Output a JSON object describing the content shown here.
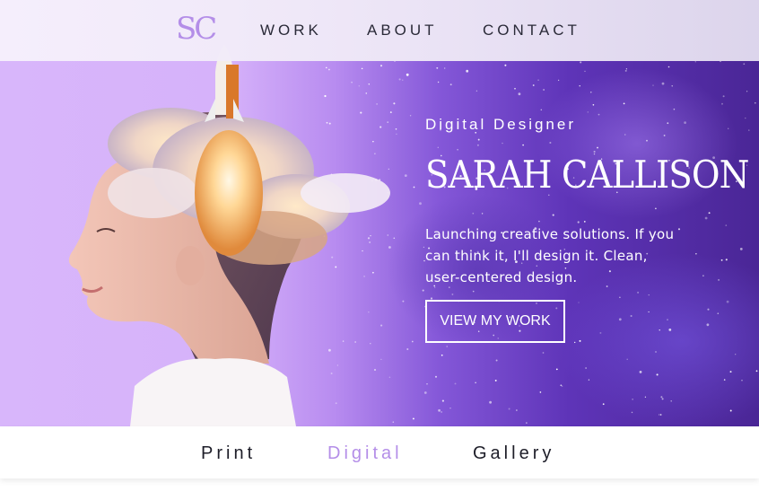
{
  "nav": {
    "logo": "SC",
    "links": [
      "WORK",
      "ABOUT",
      "CONTACT"
    ]
  },
  "hero": {
    "eyebrow": "Digital Designer",
    "name": "SARAH CALLISON",
    "tagline": "Launching creative solutions. If you can think it, I'll design it. Clean, user-centered design.",
    "cta_label": "VIEW MY WORK"
  },
  "filters": {
    "items": [
      "Print",
      "Digital",
      "Gallery"
    ],
    "active": "Digital"
  },
  "colors": {
    "accent": "#b48ee8",
    "hero_left": "#d8b6fb",
    "hero_right": "#4a2696",
    "nav_text": "#2a2a38"
  },
  "icons": [
    "rocket-illustration",
    "portrait-illustration"
  ]
}
